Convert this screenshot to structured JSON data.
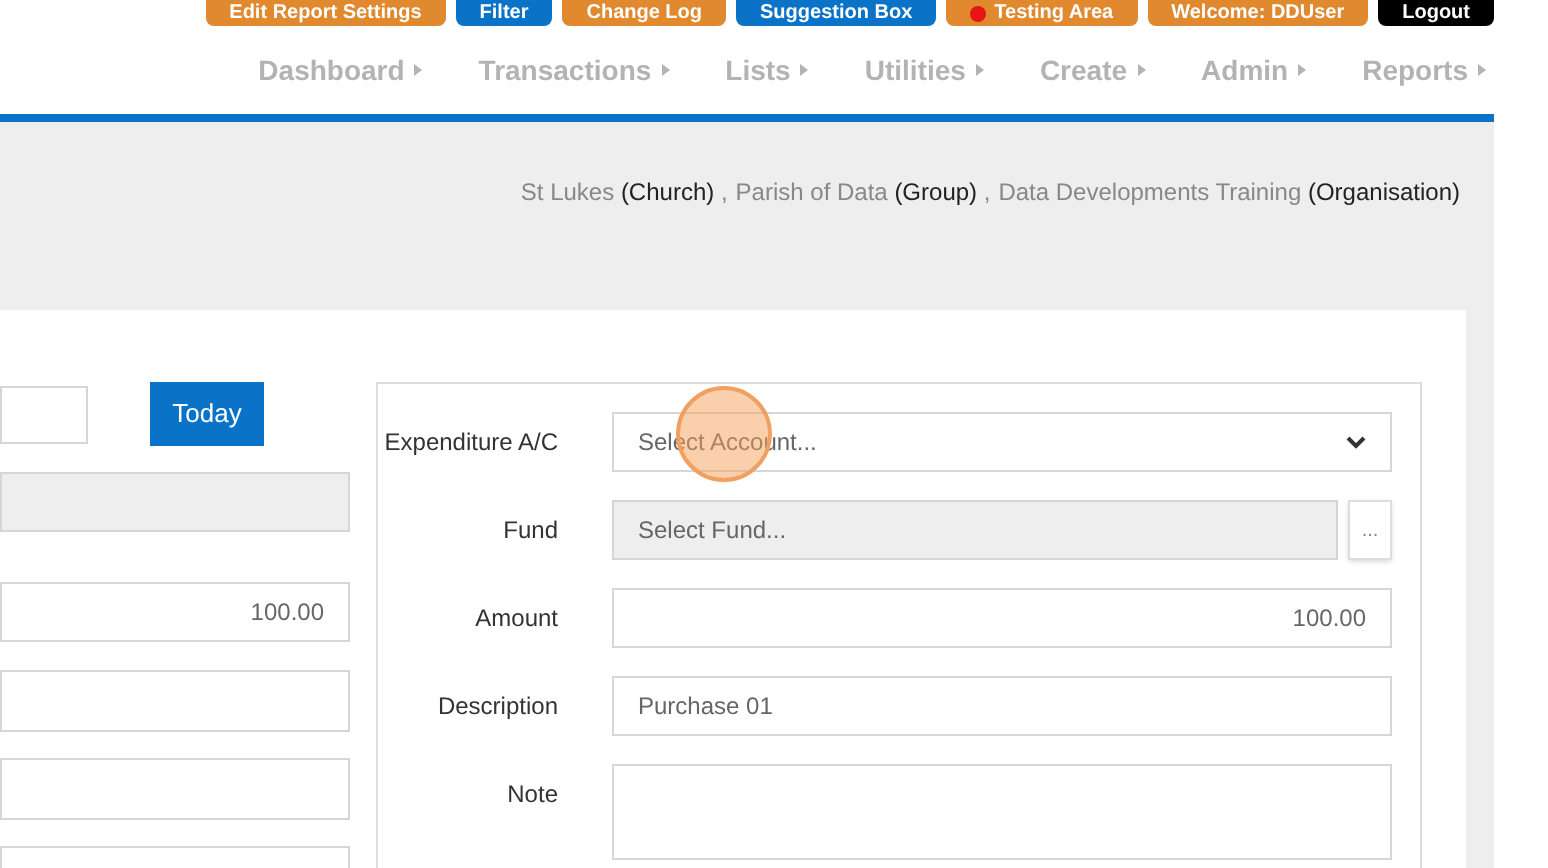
{
  "top_buttons": [
    {
      "label": "Edit Report Settings",
      "kind": "orange"
    },
    {
      "label": "Filter",
      "kind": "blue"
    },
    {
      "label": "Change Log",
      "kind": "orange"
    },
    {
      "label": "Suggestion Box",
      "kind": "blue"
    },
    {
      "label": "Testing Area",
      "kind": "orange",
      "dot": true
    },
    {
      "label": "Welcome: DDUser",
      "kind": "orange"
    },
    {
      "label": "Logout",
      "kind": "black"
    }
  ],
  "nav": [
    {
      "label": "Dashboard"
    },
    {
      "label": "Transactions"
    },
    {
      "label": "Lists"
    },
    {
      "label": "Utilities"
    },
    {
      "label": "Create"
    },
    {
      "label": "Admin"
    },
    {
      "label": "Reports"
    }
  ],
  "context": [
    {
      "name": "St Lukes",
      "type": "(Church)",
      "separator": ","
    },
    {
      "name": "Parish of Data",
      "type": "(Group)",
      "separator": ","
    },
    {
      "name": "Data Developments Training",
      "type": "(Organisation)"
    }
  ],
  "left": {
    "today_button": "Today",
    "amount": "100.00"
  },
  "form": [
    {
      "kind": "select",
      "label": "Expenditure A/C",
      "placeholder": "Select Account..."
    },
    {
      "kind": "lookup",
      "label": "Fund",
      "placeholder": "Select Fund...",
      "button": "..."
    },
    {
      "kind": "amount",
      "label": "Amount",
      "value": "100.00"
    },
    {
      "kind": "text",
      "label": "Description",
      "value": "Purchase 01"
    },
    {
      "kind": "textarea",
      "label": "Note"
    }
  ]
}
